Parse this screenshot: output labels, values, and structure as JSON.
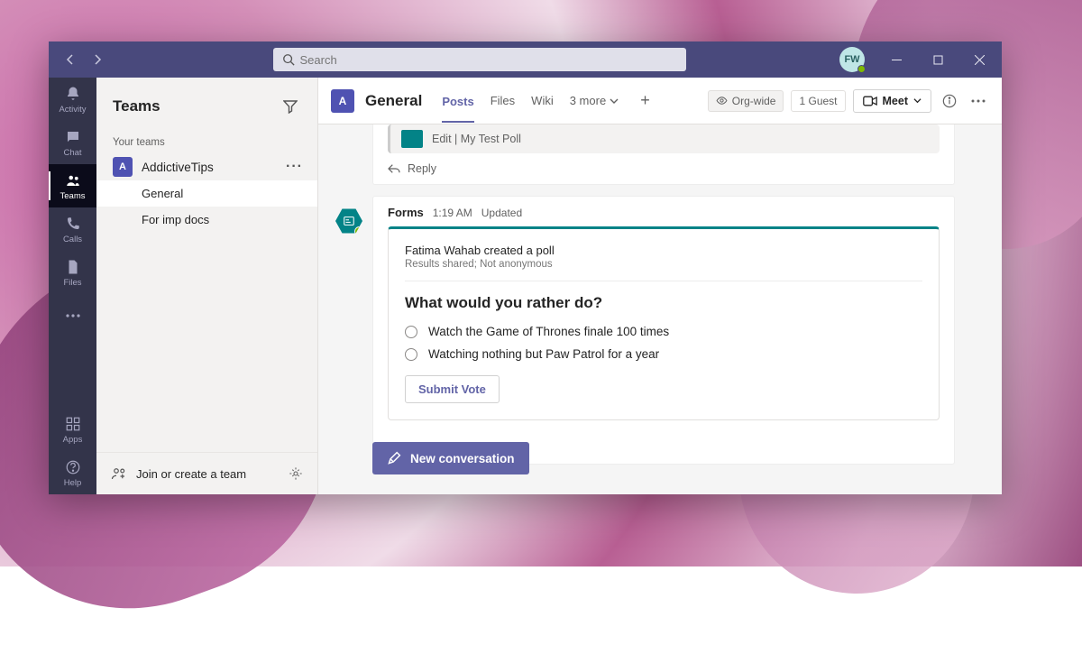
{
  "titlebar": {
    "search_placeholder": "Search",
    "avatar_initials": "FW"
  },
  "rail": {
    "activity": "Activity",
    "chat": "Chat",
    "teams": "Teams",
    "calls": "Calls",
    "files": "Files",
    "apps": "Apps",
    "help": "Help"
  },
  "sidebar": {
    "title": "Teams",
    "your_teams": "Your teams",
    "team_name": "AddictiveTips",
    "team_initial": "A",
    "channels": [
      {
        "name": "General",
        "active": true
      },
      {
        "name": "For imp docs",
        "active": false
      }
    ],
    "join_create": "Join or create a team"
  },
  "channel_header": {
    "icon_initial": "A",
    "name": "General",
    "tabs": {
      "posts": "Posts",
      "files": "Files",
      "wiki": "Wiki",
      "more": "3 more"
    },
    "org_wide": "Org-wide",
    "guest": "1 Guest",
    "meet": "Meet"
  },
  "messages": {
    "old_card_text": "Edit | My Test Poll",
    "reply_label": "Reply",
    "poll": {
      "sender": "Forms",
      "time": "1:19 AM",
      "status": "Updated",
      "created_by": "Fatima Wahab created a poll",
      "visibility": "Results shared; Not anonymous",
      "question": "What would you rather do?",
      "options": [
        "Watch the Game of Thrones finale 100 times",
        "Watching nothing but Paw Patrol for a year"
      ],
      "submit": "Submit Vote"
    },
    "new_conversation": "New conversation"
  }
}
